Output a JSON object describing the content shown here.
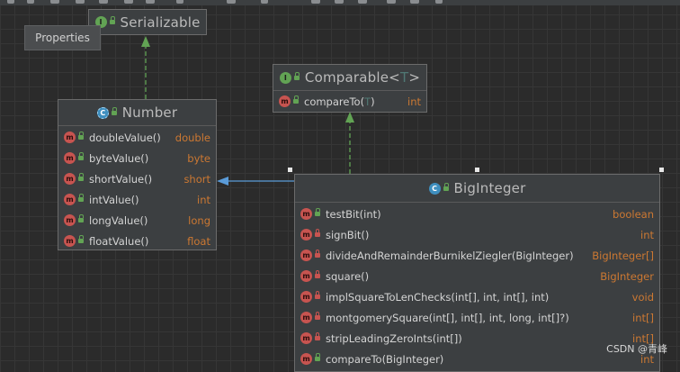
{
  "tooltip": "Properties",
  "serializable": {
    "title": "Serializable"
  },
  "comparable": {
    "title_prefix": "Comparable<",
    "type_param": "T",
    "title_suffix": ">",
    "methods": [
      {
        "name": "compareTo(",
        "arg": "T",
        "close": ")",
        "type": "int"
      }
    ]
  },
  "number": {
    "title": "Number",
    "methods": [
      {
        "name": "doubleValue()",
        "type": "double"
      },
      {
        "name": "byteValue()",
        "type": "byte"
      },
      {
        "name": "shortValue()",
        "type": "short"
      },
      {
        "name": "intValue()",
        "type": "int"
      },
      {
        "name": "longValue()",
        "type": "long"
      },
      {
        "name": "floatValue()",
        "type": "float"
      }
    ]
  },
  "biginteger": {
    "title": "BigInteger",
    "methods": [
      {
        "name": "testBit(int)",
        "type": "boolean",
        "access": "public"
      },
      {
        "name": "signBit()",
        "type": "int",
        "access": "private"
      },
      {
        "name": "divideAndRemainderBurnikelZiegler(BigInteger)",
        "type": "BigInteger[]",
        "access": "private"
      },
      {
        "name": "square()",
        "type": "BigInteger",
        "access": "private"
      },
      {
        "name": "implSquareToLenChecks(int[], int, int[], int)",
        "type": "void",
        "access": "private"
      },
      {
        "name": "montgomerySquare(int[], int[], int, long, int[]?)",
        "type": "int[]",
        "access": "private"
      },
      {
        "name": "stripLeadingZeroInts(int[])",
        "type": "int[]",
        "access": "private"
      },
      {
        "name": "compareTo(BigInteger)",
        "type": "int",
        "access": "public"
      }
    ]
  },
  "watermark": "CSDN @青峰",
  "icons": {
    "interface": "I",
    "class": "C",
    "method": "m"
  },
  "colors": {
    "background": "#2b2b2b",
    "return_type": "#cc7832",
    "interface_badge": "#62a354",
    "class_badge": "#3f8fbf",
    "method_badge": "#c75450",
    "inherit_arrow": "#5a9bd8"
  }
}
